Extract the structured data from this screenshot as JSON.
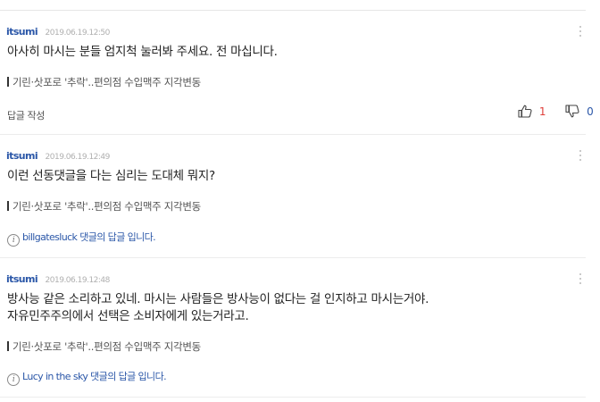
{
  "comments": [
    {
      "author": "itsumi",
      "date": "2019.06.19.12:50",
      "lines": [
        "아사히 마시는 분들 엄지척 눌러봐 주세요.  전 마십니다."
      ],
      "article": "기린·삿포로 '추락'..편의점 수입맥주 지각변동",
      "reply_label": "답글 작성",
      "up_count": "1",
      "down_count": "0"
    },
    {
      "author": "itsumi",
      "date": "2019.06.19.12:49",
      "lines": [
        "이런 선동댓글을 다는 심리는 도대체 뭐지?"
      ],
      "article": "기린·삿포로 '추락'..편의점 수입맥주 지각변동",
      "reply_to": "billgatesluck 댓글의 답글 입니다."
    },
    {
      "author": "itsumi",
      "date": "2019.06.19.12:48",
      "lines": [
        "방사능 같은 소리하고 있네. 마시는 사람들은 방사능이 없다는 걸 인지하고 마시는거야.",
        "자유민주주의에서 선택은 소비자에게 있는거라고."
      ],
      "article": "기린·삿포로 '추락'..편의점 수입맥주 지각변동",
      "reply_to": "Lucy in the sky 댓글의 답글 입니다."
    }
  ],
  "icons": {
    "more": "more-vertical-icon",
    "up": "thumbs-up-icon",
    "down": "thumbs-down-icon",
    "info": "info-icon"
  },
  "colors": {
    "author": "#2b57a8",
    "upvote": "#e0403b",
    "downvote": "#2b57a8"
  }
}
